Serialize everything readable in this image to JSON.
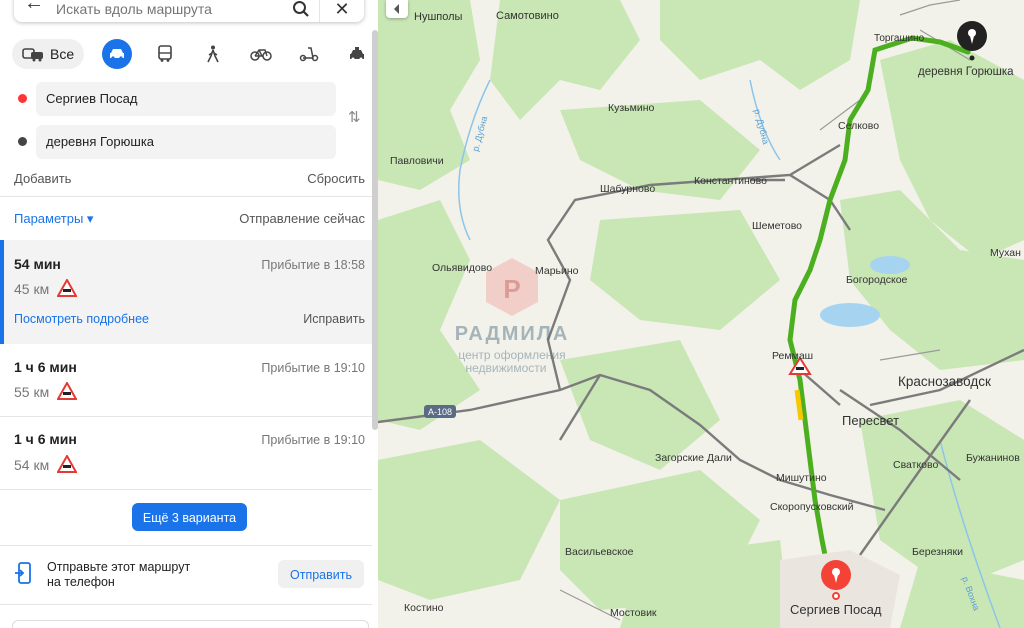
{
  "search": {
    "placeholder": "Искать вдоль маршрута"
  },
  "modes": {
    "all_label": "Все"
  },
  "points": {
    "from": "Сергиев Посад",
    "to": "деревня Горюшка"
  },
  "actions": {
    "add": "Добавить",
    "reset": "Сбросить"
  },
  "params": {
    "label": "Параметры ▾",
    "departure": "Отправление сейчас"
  },
  "routes": [
    {
      "time": "54 мин",
      "arrival": "Прибытие в 18:58",
      "distance": "45 км",
      "details": "Посмотреть подробнее",
      "fix": "Исправить"
    },
    {
      "time": "1 ч 6 мин",
      "arrival": "Прибытие в 19:10",
      "distance": "55 км"
    },
    {
      "time": "1 ч 6 мин",
      "arrival": "Прибытие в 19:10",
      "distance": "54 км"
    }
  ],
  "more_variants": "Ещё 3 варианта",
  "send": {
    "text_line1": "Отправьте этот маршрут",
    "text_line2": "на телефон",
    "button": "Отправить"
  },
  "colors": {
    "accent": "#1a73e8",
    "route": "#4caf1f",
    "start": "#f33",
    "end": "#222",
    "forest": "#c9e6b5",
    "field": "#f2f2ea"
  },
  "map": {
    "places": [
      {
        "name": "Нушполы"
      },
      {
        "name": "Самотовино"
      },
      {
        "name": "Торгашино"
      },
      {
        "name": "деревня Горюшка"
      },
      {
        "name": "Кузьмино"
      },
      {
        "name": "Селково"
      },
      {
        "name": "Павловичи"
      },
      {
        "name": "Шабурново"
      },
      {
        "name": "Константиново"
      },
      {
        "name": "Шеметово"
      },
      {
        "name": "Мухан"
      },
      {
        "name": "Ольявидово"
      },
      {
        "name": "Марьино"
      },
      {
        "name": "Богородское"
      },
      {
        "name": "Реммаш"
      },
      {
        "name": "Краснозаводск"
      },
      {
        "name": "Пересвет"
      },
      {
        "name": "Загорские Дали"
      },
      {
        "name": "Мишутино"
      },
      {
        "name": "Сватково"
      },
      {
        "name": "Бужанинов"
      },
      {
        "name": "Скоропусковский"
      },
      {
        "name": "Березняки"
      },
      {
        "name": "Васильевское"
      },
      {
        "name": "Костино"
      },
      {
        "name": "Мостовик"
      },
      {
        "name": "Сергиев Посад"
      }
    ],
    "rivers": [
      {
        "name": "р. Дубна"
      },
      {
        "name": "р. Дубна"
      },
      {
        "name": "р. Вохна"
      }
    ],
    "highway": "А-108",
    "watermark": {
      "title": "РАДМИЛА",
      "sub1": "центр оформления",
      "sub2": "недвижимости"
    }
  }
}
